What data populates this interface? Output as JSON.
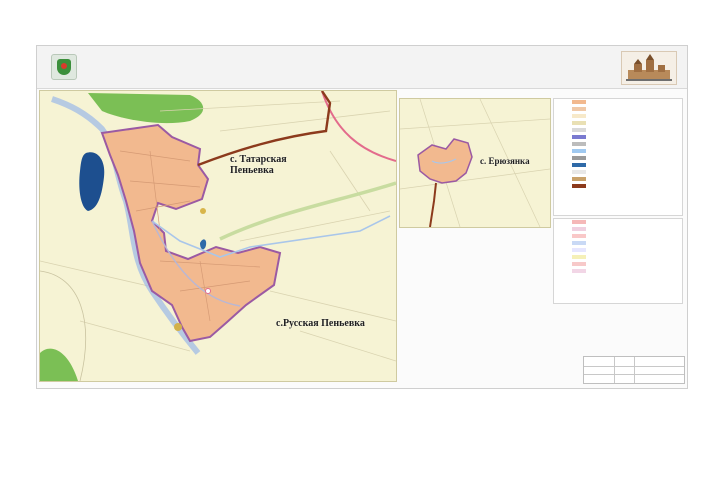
{
  "header": {
    "line1": "",
    "line2": "",
    "title": "",
    "subtitle": "",
    "emblem_icon": "coat-of-arms-icon",
    "logo_icon": "church-logo-icon"
  },
  "map": {
    "labels": {
      "village_top": "с. Татарская Пеньевка",
      "village_bottom": "с.Русская Пеньевка",
      "village_inset": "с. Ерюзянка"
    }
  },
  "legend": {
    "title": "",
    "items": [
      "",
      "",
      "",
      "",
      "",
      "",
      "",
      "",
      "",
      "",
      "",
      "",
      ""
    ],
    "swatches": [
      "#f2b98f",
      "#f0c9a8",
      "#f7e9c9",
      "#e9e0b4",
      "#d9d9d9",
      "#7a7ad0",
      "#bcbcbc",
      "#a0c9f0",
      "#9a9a9a",
      "#2f6aa8",
      "#e8e8e8",
      "#c9a26b",
      "#8c3a1c"
    ]
  },
  "legend2": {
    "title": "",
    "items": [
      "",
      "",
      "",
      "",
      "",
      "",
      "",
      ""
    ],
    "swatches": [
      "#f5b8b8",
      "#f0d0e0",
      "#f9c8c8",
      "#c9d9f5",
      "#e6e6ff",
      "#f5f0b8",
      "#f7c9c9",
      "#f2d6e6"
    ]
  },
  "stamp": {
    "text": ""
  },
  "colors": {
    "settlement_fill": "#f2b98f",
    "settlement_stroke": "#d59a74",
    "river_border": "#9b5aa3",
    "water": "#1d4f8f",
    "forest": "#7bbf55",
    "base": "#f6f3d4",
    "road_main": "#b5663a",
    "road_pink": "#e36b8c"
  }
}
